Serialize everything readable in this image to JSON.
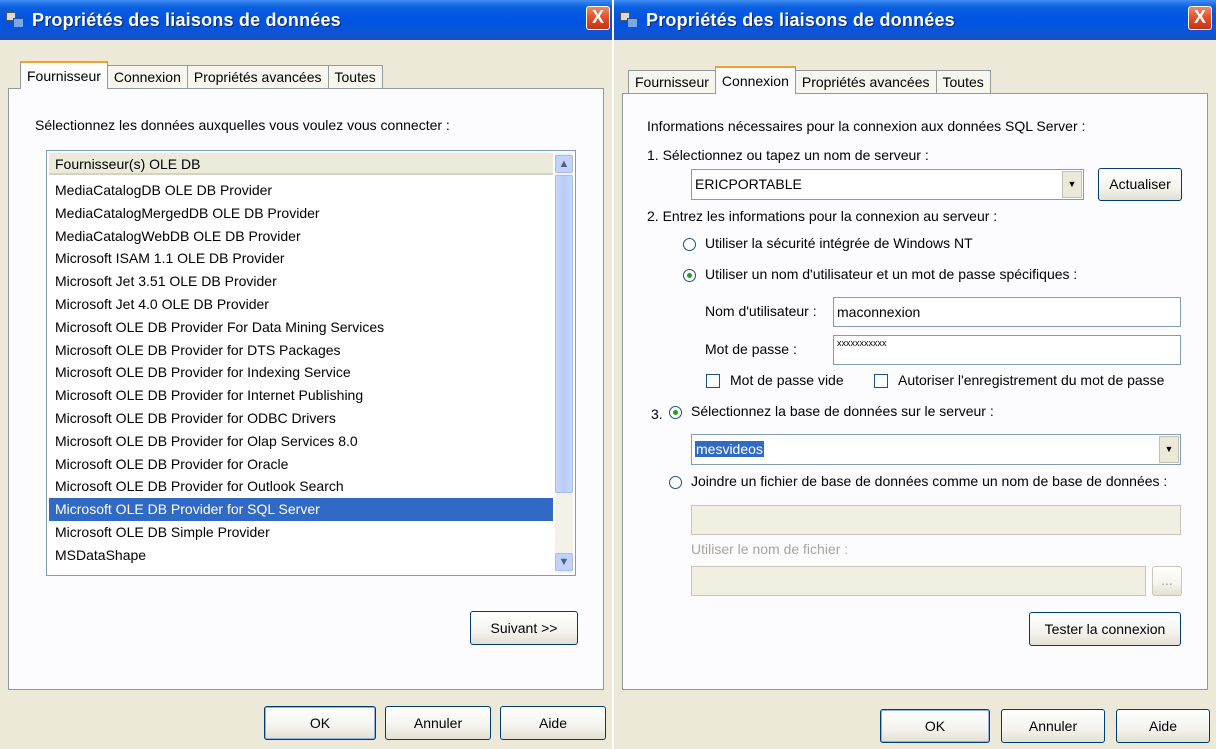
{
  "dialog_title": "Propriétés des liaisons de données",
  "close_label": "X",
  "tabs": [
    "Fournisseur",
    "Connexion",
    "Propriétés avancées",
    "Toutes"
  ],
  "buttons": {
    "ok": "OK",
    "cancel": "Annuler",
    "help": "Aide"
  },
  "provider_tab": {
    "instruction": "Sélectionnez les données auxquelles vous voulez vous connecter :",
    "list_header": "Fournisseur(s) OLE DB",
    "providers": [
      "MediaCatalogDB OLE DB Provider",
      "MediaCatalogMergedDB OLE DB Provider",
      "MediaCatalogWebDB OLE DB Provider",
      "Microsoft ISAM 1.1 OLE DB Provider",
      "Microsoft Jet 3.51 OLE DB Provider",
      "Microsoft Jet 4.0 OLE DB Provider",
      "Microsoft OLE DB Provider For Data Mining Services",
      "Microsoft OLE DB Provider for DTS Packages",
      "Microsoft OLE DB Provider for Indexing Service",
      "Microsoft OLE DB Provider for Internet Publishing",
      "Microsoft OLE DB Provider for ODBC Drivers",
      "Microsoft OLE DB Provider for Olap Services 8.0",
      "Microsoft OLE DB Provider for Oracle",
      "Microsoft OLE DB Provider for Outlook Search",
      "Microsoft OLE DB Provider for SQL Server",
      "Microsoft OLE DB Simple Provider",
      "MSDataShape"
    ],
    "selected_provider": "Microsoft OLE DB Provider for SQL Server",
    "next_button": "Suivant >>"
  },
  "connection_tab": {
    "intro": "Informations nécessaires pour la connexion aux données SQL Server :",
    "step1": "1. Sélectionnez ou tapez un nom de serveur :",
    "server_value": "ERICPORTABLE",
    "refresh_button": "Actualiser",
    "step2": "2. Entrez les informations pour la connexion au serveur :",
    "radio_nt": "Utiliser la sécurité intégrée de Windows NT",
    "radio_user": "Utiliser un nom d'utilisateur et un mot de passe spécifiques :",
    "auth_mode": "user",
    "username_label": "Nom d'utilisateur :",
    "username_value": "maconnexion",
    "password_label": "Mot de passe :",
    "password_value": "xxxxxxxxxxx",
    "blank_password": "Mot de passe vide",
    "blank_password_checked": false,
    "save_password": "Autoriser l'enregistrement du mot de passe",
    "save_password_checked": false,
    "step3_prefix": "3.",
    "radio_select_db": "Sélectionnez la base de données sur le serveur :",
    "database_value": "mesvideos",
    "radio_attach": "Joindre un fichier de base de données comme un nom de base de données :",
    "db_source": "select",
    "filename_label": "Utiliser le nom de fichier :",
    "browse_button": "...",
    "test_button": "Tester la connexion"
  }
}
